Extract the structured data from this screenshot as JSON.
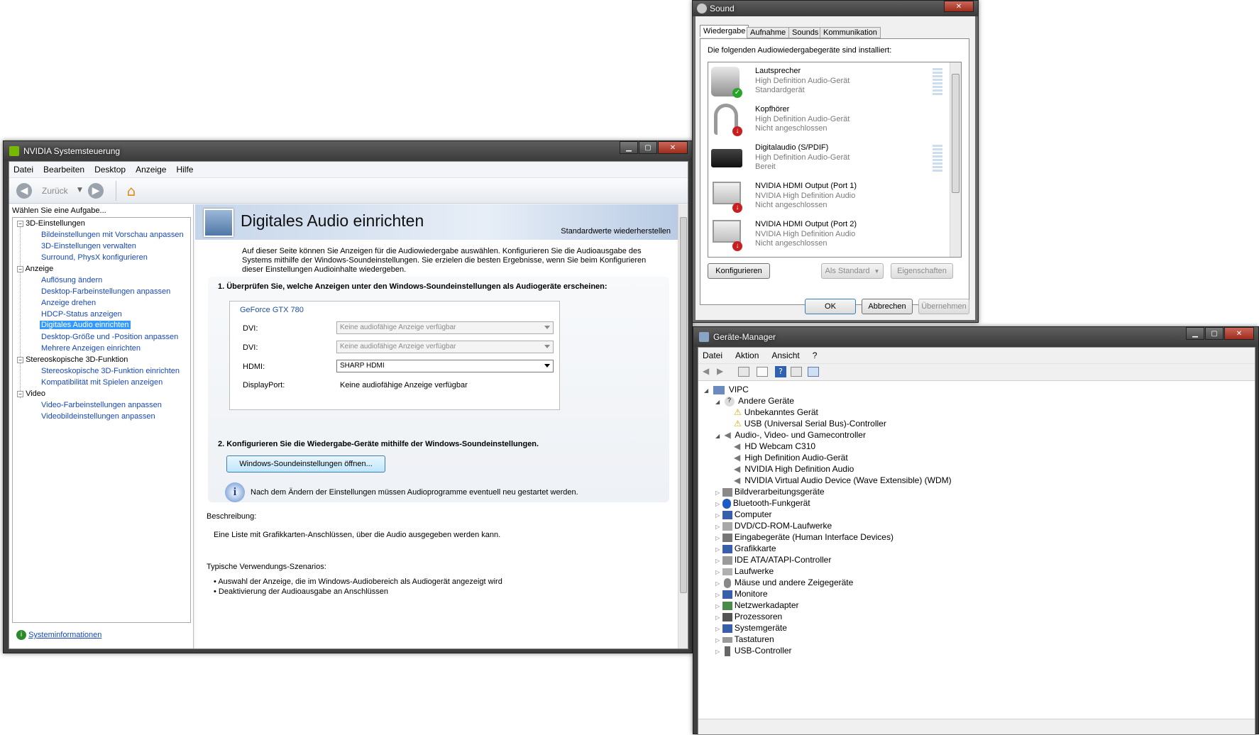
{
  "nvidia": {
    "title": "NVIDIA Systemsteuerung",
    "menu": [
      "Datei",
      "Bearbeiten",
      "Desktop",
      "Anzeige",
      "Hilfe"
    ],
    "back_label": "Zurück",
    "task_header": "Wählen Sie eine Aufgabe...",
    "tree": {
      "cat_3d": "3D-Einstellungen",
      "items_3d": [
        "Bildeinstellungen mit Vorschau anpassen",
        "3D-Einstellungen verwalten",
        "Surround, PhysX konfigurieren"
      ],
      "cat_display": "Anzeige",
      "items_display": [
        "Auflösung ändern",
        "Desktop-Farbeinstellungen anpassen",
        "Anzeige drehen",
        "HDCP-Status anzeigen",
        "Digitales Audio einrichten",
        "Desktop-Größe und -Position anpassen",
        "Mehrere Anzeigen einrichten"
      ],
      "cat_stereo": "Stereoskopische 3D-Funktion",
      "items_stereo": [
        "Stereoskopische 3D-Funktion einrichten",
        "Kompatibilität mit Spielen anzeigen"
      ],
      "cat_video": "Video",
      "items_video": [
        "Video-Farbeinstellungen anpassen",
        "Videobildeinstellungen anpassen"
      ]
    },
    "sysinfo": "Systeminformationen",
    "page_title": "Digitales Audio einrichten",
    "restore_defaults": "Standardwerte wiederherstellen",
    "intro": "Auf dieser Seite können Sie Anzeigen für die Audiowiedergabe auswählen. Konfigurieren Sie die Audioausgabe des Systems mithilfe der Windows-Soundeinstellungen. Sie erzielen die besten Ergebnisse, wenn Sie beim Konfigurieren dieser Einstellungen Audioinhalte wiedergeben.",
    "step1": "1. Überprüfen Sie, welche Anzeigen unter den Windows-Soundeinstellungen als Audiogeräte erscheinen:",
    "gpu_group": "GeForce GTX 780",
    "ports": [
      {
        "label": "DVI:",
        "value": "Keine audiofähige Anzeige verfügbar"
      },
      {
        "label": "DVI:",
        "value": "Keine audiofähige Anzeige verfügbar"
      },
      {
        "label": "HDMI:",
        "value": "SHARP HDMI"
      },
      {
        "label": "DisplayPort:",
        "value": "Keine audiofähige Anzeige verfügbar"
      }
    ],
    "step2": "2. Konfigurieren Sie die Wiedergabe-Geräte mithilfe der Windows-Soundeinstellungen.",
    "open_sound_btn": "Windows-Soundeinstellungen öffnen...",
    "info_note": "Nach dem Ändern der Einstellungen müssen Audioprogramme eventuell neu gestartet werden.",
    "desc_label": "Beschreibung:",
    "desc_text": "Eine Liste mit Grafikkarten-Anschlüssen, über die Audio ausgegeben werden kann.",
    "usage_label": "Typische Verwendungs-Szenarios:",
    "usage_items": [
      "Auswahl der Anzeige, die im Windows-Audiobereich als Audiogerät angezeigt wird",
      "Deaktivierung der Audioausgabe an Anschlüssen"
    ]
  },
  "sound": {
    "title": "Sound",
    "tabs": [
      "Wiedergabe",
      "Aufnahme",
      "Sounds",
      "Kommunikation"
    ],
    "header": "Die folgenden Audiowiedergabegeräte sind installiert:",
    "devices": [
      {
        "name": "Lautsprecher",
        "driver": "High Definition Audio-Gerät",
        "status": "Standardgerät"
      },
      {
        "name": "Kopfhörer",
        "driver": "High Definition Audio-Gerät",
        "status": "Nicht angeschlossen"
      },
      {
        "name": "Digitalaudio (S/PDIF)",
        "driver": "High Definition Audio-Gerät",
        "status": "Bereit"
      },
      {
        "name": "NVIDIA HDMI Output (Port 1)",
        "driver": "NVIDIA High Definition Audio",
        "status": "Nicht angeschlossen"
      },
      {
        "name": "NVIDIA HDMI Output (Port 2)",
        "driver": "NVIDIA High Definition Audio",
        "status": "Nicht angeschlossen"
      }
    ],
    "configure": "Konfigurieren",
    "set_default": "Als Standard",
    "properties": "Eigenschaften",
    "ok": "OK",
    "cancel": "Abbrechen",
    "apply": "Übernehmen"
  },
  "devmgr": {
    "title": "Geräte-Manager",
    "menu": [
      "Datei",
      "Aktion",
      "Ansicht",
      "?"
    ],
    "root": "VIPC",
    "other_devices": "Andere Geräte",
    "other_children": [
      "Unbekanntes Gerät",
      "USB (Universal Serial Bus)-Controller"
    ],
    "audio": "Audio-, Video- und Gamecontroller",
    "audio_children": [
      "HD Webcam C310",
      "High Definition Audio-Gerät",
      "NVIDIA High Definition Audio",
      "NVIDIA Virtual Audio Device (Wave Extensible) (WDM)"
    ],
    "categories": [
      "Bildverarbeitungsgeräte",
      "Bluetooth-Funkgerät",
      "Computer",
      "DVD/CD-ROM-Laufwerke",
      "Eingabegeräte (Human Interface Devices)",
      "Grafikkarte",
      "IDE ATA/ATAPI-Controller",
      "Laufwerke",
      "Mäuse und andere Zeigegeräte",
      "Monitore",
      "Netzwerkadapter",
      "Prozessoren",
      "Systemgeräte",
      "Tastaturen",
      "USB-Controller"
    ]
  }
}
